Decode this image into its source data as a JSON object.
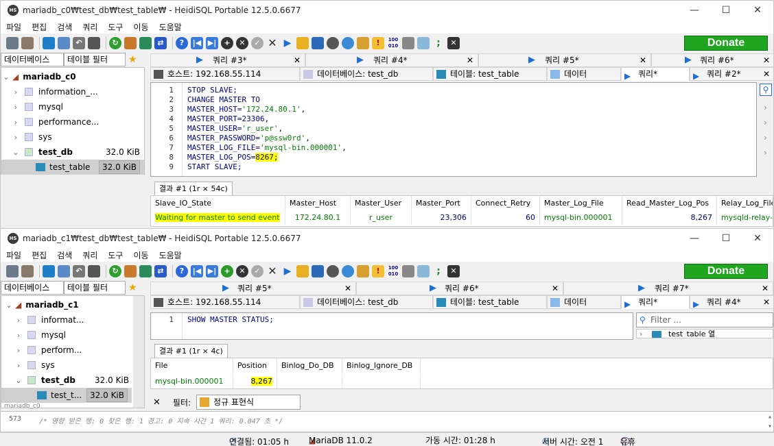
{
  "window0": {
    "title": "mariadb_c0₩test_db₩test_table₩ - HeidiSQL Portable 12.5.0.6677",
    "menu": [
      "파일",
      "편집",
      "검색",
      "쿼리",
      "도구",
      "이동",
      "도움말"
    ],
    "donate": "Donate",
    "left_tabs": [
      "데이터베이스",
      "테이블 필터"
    ],
    "tree": {
      "server": "mariadb_c0",
      "databases": [
        "information_...",
        "mysql",
        "performance...",
        "sys"
      ],
      "open_db": {
        "name": "test_db",
        "size": "32.0 KiB"
      },
      "table": {
        "name": "test_table",
        "size": "32.0 KiB"
      }
    },
    "query_tabs": [
      "쿼리 #3*",
      "쿼리 #4*",
      "쿼리 #5*",
      "쿼리 #6*"
    ],
    "panel_tabs": [
      "호스트: 192.168.55.114",
      "데이터베이스: test_db",
      "테이블: test_table",
      "데이터",
      "쿼리*",
      "쿼리 #2*"
    ],
    "code": [
      {
        "n": "1",
        "kw": "STOP SLAVE;",
        "str": "",
        "num": "",
        "tail": ""
      },
      {
        "n": "2",
        "kw": "CHANGE MASTER TO",
        "str": "",
        "num": "",
        "tail": ""
      },
      {
        "n": "3",
        "kw": "MASTER_HOST=",
        "str": "'172.24.80.1'",
        "num": "",
        "tail": ","
      },
      {
        "n": "4",
        "kw": "MASTER_PORT=",
        "str": "",
        "num": "23306",
        "tail": ","
      },
      {
        "n": "5",
        "kw": "MASTER_USER=",
        "str": "'r_user'",
        "num": "",
        "tail": ","
      },
      {
        "n": "6",
        "kw": "MASTER_PASSWORD=",
        "str": "'p@ssw0rd'",
        "num": "",
        "tail": ","
      },
      {
        "n": "7",
        "kw": "MASTER_LOG_FILE=",
        "str": "'mysql-bin.000001'",
        "num": "",
        "tail": ","
      },
      {
        "n": "8",
        "kw": "MASTER_LOG_POS=",
        "str": "",
        "num": "8267",
        "tail": ";"
      },
      {
        "n": "9",
        "kw": "START SLAVE;",
        "str": "",
        "num": "",
        "tail": ""
      }
    ],
    "result_tab": "결과 #1 (1r × 54c)",
    "grid_headers": [
      "Slave_IO_State",
      "Master_Host",
      "Master_User",
      "Master_Port",
      "Connect_Retry",
      "Master_Log_File",
      "Read_Master_Log_Pos",
      "Relay_Log_File"
    ],
    "grid_row": [
      "Waiting for master to send event",
      "172.24.80.1",
      "r_user",
      "23,306",
      "60",
      "mysql-bin.000001",
      "8,267",
      "mysqld-relay-b"
    ]
  },
  "window1": {
    "title": "mariadb_c1₩test_db₩test_table₩ - HeidiSQL Portable 12.5.0.6677",
    "menu": [
      "파일",
      "편집",
      "검색",
      "쿼리",
      "도구",
      "이동",
      "도움말"
    ],
    "donate": "Donate",
    "left_tabs": [
      "데이터베이스",
      "테이블 필터"
    ],
    "tree": {
      "server": "mariadb_c1",
      "databases": [
        "informat...",
        "mysql",
        "perform...",
        "sys"
      ],
      "open_db": {
        "name": "test_db",
        "size": "32.0 KiB"
      },
      "table": {
        "name": "test_t...",
        "size": "32.0 KiB"
      },
      "next_server": "mariadb_c0"
    },
    "query_tabs": [
      "쿼리 #5*",
      "쿼리 #6*",
      "쿼리 #7*"
    ],
    "panel_tabs": [
      "호스트: 192.168.55.114",
      "데이터베이스: test_db",
      "테이블: test_table",
      "데이터",
      "쿼리*",
      "쿼리 #4*"
    ],
    "code": [
      {
        "n": "1",
        "kw": "SHOW MASTER STATUS;"
      }
    ],
    "filter_placeholder": "Filter ...",
    "helper_item": "test_table 열",
    "result_tab": "결과 #1 (1r × 4c)",
    "grid_headers": [
      "File",
      "Position",
      "Binlog_Do_DB",
      "Binlog_Ignore_DB"
    ],
    "grid_row": [
      "mysql-bin.000001",
      "8,267",
      "",
      ""
    ],
    "filter_label": "필터:",
    "filter_value": "정규 표현식"
  },
  "log": {
    "line": "573",
    "text": "/* 영향 받은 행: 0  찾은 행: 1  경고: 0  지속 시간 1 쿼리: 0.047 초 */"
  },
  "status": {
    "connected": "연결됨: 01:05 h",
    "server": "MariaDB 11.0.2",
    "uptime": "가동 시간: 01:28 h",
    "server_time": "서버 시간: 오전 1",
    "idle": "유휴"
  },
  "colors": {
    "donate": "#1fa51f",
    "highlight": "#ffff00",
    "keyword": "#00008b",
    "string": "#008000"
  }
}
